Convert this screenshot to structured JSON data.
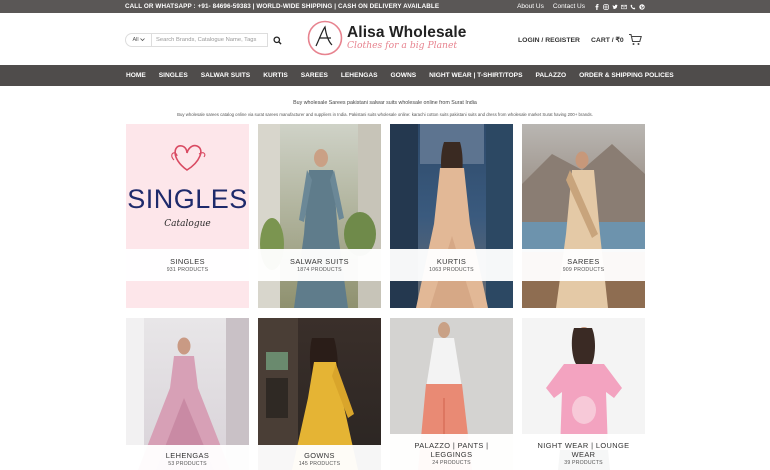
{
  "topbar": {
    "message": "CALL OR WHATSAPP : +91- 84696-59383 | WORLD-WIDE SHIPPING | CASH ON DELIVERY AVAILABLE",
    "about": "About Us",
    "contact": "Contact Us",
    "socials": [
      "facebook-icon",
      "instagram-icon",
      "twitter-icon",
      "email-icon",
      "phone-icon",
      "pinterest-icon"
    ]
  },
  "header": {
    "search_scope": "All",
    "search_placeholder": "Search Brands, Catalogue Name, Tags",
    "logo_script": "Alisa",
    "logo_title": "Alisa Wholesale",
    "logo_tagline": "Clothes for a big Planet",
    "login": "LOGIN / REGISTER",
    "cart": "CART / ₹0",
    "cart_count": "0"
  },
  "nav": [
    "HOME",
    "SINGLES",
    "SALWAR SUITS",
    "KURTIS",
    "SAREES",
    "LEHENGAS",
    "GOWNS",
    "NIGHT WEAR | T-SHIRT/TOPS",
    "PALAZZO",
    "ORDER & SHIPPING POLICES"
  ],
  "intro": {
    "line1": "Buy wholesale Sarees pakistani salwar suits wholesale online from Surat India",
    "line2": "Buy wholesale sarees catalog online via surat sarees manufacturer and suppliers in India. Pakistani suits wholesale online: karachi cotton suits pakistani suits and dress from wholesale market Surat having 200+ brands."
  },
  "categories": [
    {
      "name": "SINGLES",
      "count": "931 PRODUCTS",
      "art": {
        "big": "SINGLES",
        "small": "Catalogue"
      }
    },
    {
      "name": "SALWAR SUITS",
      "count": "1874 PRODUCTS"
    },
    {
      "name": "KURTIS",
      "count": "1063 PRODUCTS"
    },
    {
      "name": "SAREES",
      "count": "909 PRODUCTS"
    },
    {
      "name": "LEHENGAS",
      "count": "53 PRODUCTS"
    },
    {
      "name": "GOWNS",
      "count": "145 PRODUCTS"
    },
    {
      "name": "PALAZZO | PANTS | LEGGINGS",
      "count": "24 PRODUCTS"
    },
    {
      "name": "NIGHT WEAR | LOUNGE WEAR",
      "count": "39 PRODUCTS"
    }
  ],
  "colors": {
    "topbar": "#5a5756",
    "nav": "#4f4c4b",
    "accent_pink": "#e7838f",
    "singles_navy": "#1e2a6b"
  }
}
